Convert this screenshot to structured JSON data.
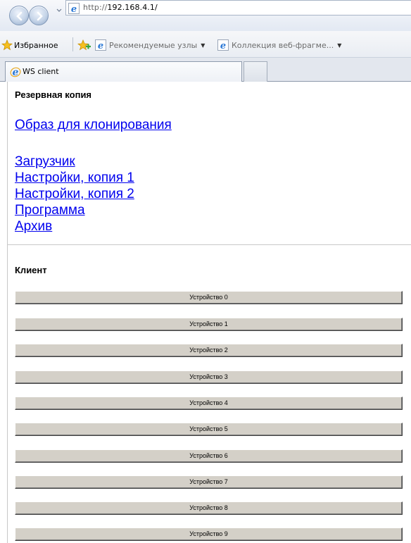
{
  "browser": {
    "url_prefix": "http://",
    "url_host": "192.168.4.1/",
    "favorites_label": "Избранное",
    "suggested_sites": "Рекомендуемые узлы",
    "web_slice_gallery": "Коллекция веб-фрагме...",
    "tab_title": "WS client"
  },
  "backup": {
    "title": "Резервная копия",
    "clone_image_link": "Образ для клонирования",
    "links": [
      "Загрузчик",
      "Настройки, копия 1",
      "Настройки, копия 2",
      "Программа",
      "Архив"
    ]
  },
  "client": {
    "title": "Клиент",
    "devices": [
      "Устройство 0",
      "Устройство 1",
      "Устройство 2",
      "Устройство 3",
      "Устройство 4",
      "Устройство 5",
      "Устройство 6",
      "Устройство 7",
      "Устройство 8",
      "Устройство 9"
    ]
  },
  "colors": {
    "link": "#0000ee",
    "button_face": "#d4d0c8"
  },
  "icons": {
    "back": "back-arrow-icon",
    "forward": "forward-arrow-icon",
    "ie_page": "ie-logo-icon",
    "favorites": "star-icon",
    "add_favorite": "add-to-favorites-icon"
  }
}
